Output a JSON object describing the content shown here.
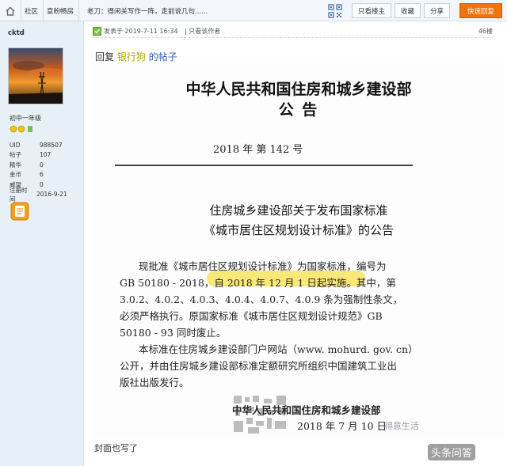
{
  "breadcrumb": {
    "items": [
      "社区",
      "意粉畅房"
    ],
    "title": "老刀：得闲关写作一阵，走前说几句......"
  },
  "toolbar": {
    "only_author": "只看楼主",
    "favorite": "收藏",
    "share": "分享",
    "quick_reply": "快速回复"
  },
  "user": {
    "name": "cktd",
    "level": "初中一年级",
    "stats": [
      {
        "k": "UID",
        "v": "988507"
      },
      {
        "k": "帖子",
        "v": "107"
      },
      {
        "k": "精华",
        "v": "0"
      },
      {
        "k": "金币",
        "v": "6"
      },
      {
        "k": "威望",
        "v": "0"
      },
      {
        "k": "注册时间",
        "v": "2016-9-21"
      }
    ]
  },
  "post": {
    "posted": "发表于 2019-7-11 16:34",
    "only_author": "只看该作者",
    "floor": "46楼",
    "reply_prefix": "回复",
    "reply_user": "银行狗",
    "reply_suffix": "的帖子",
    "footer": "封面也写了"
  },
  "document": {
    "org": "中华人民共和国住房和城乡建设部",
    "notice": "公    告",
    "number": "2018 年   第 142 号",
    "title1": "住房城乡建设部关于发布国家标准",
    "title2": "《城市居住区规划设计标准》的公告",
    "body": [
      "现批准《城市居住区规划设计标准》为国家标准，编号为",
      "GB 50180 - 2018，自 2018 年 12 月 1 日起实施。其中，第",
      "3.0.2、4.0.2、4.0.3、4.0.4、4.0.7、4.0.9 条为强制性条文，",
      "必须严格执行。原国家标准《城市居住区规划设计规范》GB",
      "50180 - 93 同时废止。",
      "本标准在住房城乡建设部门户网站（www. mohurd. gov. cn）",
      "公开，并由住房城乡建设部标准定额研究所组织中国建筑工业出",
      "版社出版发行。"
    ],
    "sign_org": "中华人民共和国住房和城乡建设部",
    "sign_date": "2018 年 7 月 10 日"
  },
  "watermark": {
    "text1": "得意生活",
    "text2": "头条问答"
  }
}
